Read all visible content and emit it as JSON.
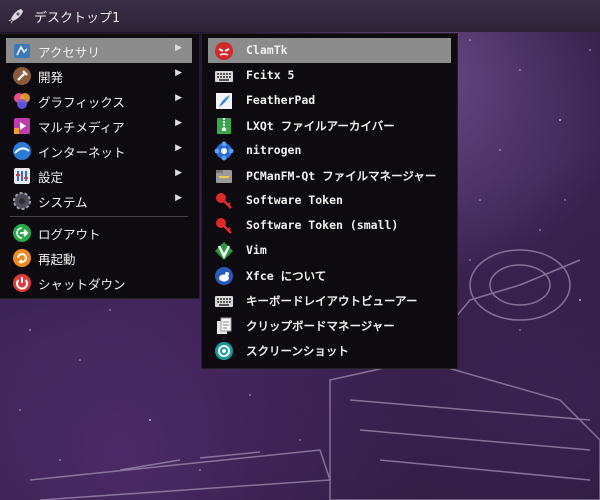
{
  "panel": {
    "title": "デスクトップ1",
    "launcher_icon": "rocket-icon"
  },
  "main_menu": {
    "items": [
      {
        "label": "アクセサリ",
        "icon": "accessories-icon",
        "has_submenu": true,
        "active": true
      },
      {
        "label": "開発",
        "icon": "hammer-icon",
        "has_submenu": true
      },
      {
        "label": "グラフィックス",
        "icon": "graphics-icon",
        "has_submenu": true
      },
      {
        "label": "マルチメディア",
        "icon": "multimedia-icon",
        "has_submenu": true
      },
      {
        "label": "インターネット",
        "icon": "internet-icon",
        "has_submenu": true
      },
      {
        "label": "設定",
        "icon": "settings-icon",
        "has_submenu": true
      },
      {
        "label": "システム",
        "icon": "system-gear-icon",
        "has_submenu": true
      }
    ],
    "session_items": [
      {
        "label": "ログアウト",
        "icon": "logout-icon"
      },
      {
        "label": "再起動",
        "icon": "reboot-icon"
      },
      {
        "label": "シャットダウン",
        "icon": "power-icon"
      }
    ],
    "arrow": "▶"
  },
  "sub_menu": {
    "items": [
      {
        "label": "ClamTk",
        "icon": "clamtk-icon",
        "active": true
      },
      {
        "label": "Fcitx 5",
        "icon": "keyboard-icon"
      },
      {
        "label": "FeatherPad",
        "icon": "feather-icon"
      },
      {
        "label": "LXQt ファイルアーカイバー",
        "icon": "archive-icon"
      },
      {
        "label": "nitrogen",
        "icon": "nitrogen-icon"
      },
      {
        "label": "PCManFM-Qt ファイルマネージャー",
        "icon": "file-manager-icon"
      },
      {
        "label": "Software Token",
        "icon": "token-key-icon"
      },
      {
        "label": "Software Token (small)",
        "icon": "token-key-small-icon"
      },
      {
        "label": "Vim",
        "icon": "vim-icon"
      },
      {
        "label": "Xfce について",
        "icon": "xfce-icon"
      },
      {
        "label": "キーボードレイアウトビューアー",
        "icon": "keyboard-layout-icon"
      },
      {
        "label": "クリップボードマネージャー",
        "icon": "clipboard-icon"
      },
      {
        "label": "スクリーンショット",
        "icon": "screenshot-icon"
      }
    ]
  },
  "colors": {
    "menu_bg": "#0d0b0f",
    "highlight": "#8c8c8c",
    "panel_bg": "#2e2438"
  }
}
